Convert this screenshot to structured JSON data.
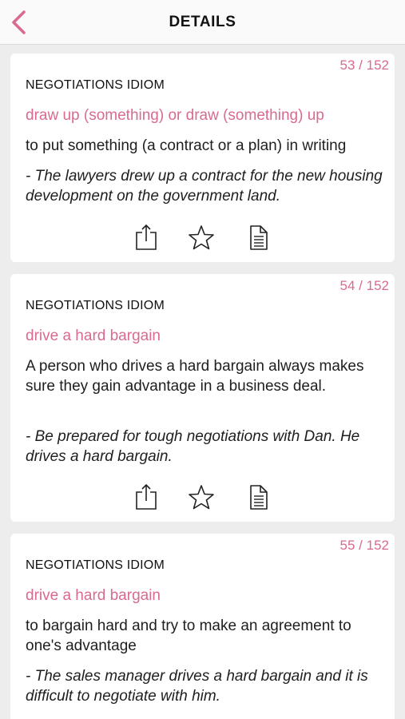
{
  "header": {
    "title": "DETAILS",
    "back_icon": "chevron-left-icon"
  },
  "colors": {
    "accent": "#d96a92",
    "background": "#ededee",
    "card": "#ffffff"
  },
  "cards": [
    {
      "counter": "53 / 152",
      "category": "NEGOTIATIONS IDIOM",
      "idiom": "draw up (something) or draw (something) up",
      "definition": "to put something (a contract or a plan) in writing",
      "example": "- The lawyers drew up a contract for the new housing development on the government land."
    },
    {
      "counter": "54 / 152",
      "category": "NEGOTIATIONS IDIOM",
      "idiom": "drive a hard bargain",
      "definition": "A person who drives a hard bargain always makes sure they gain advantage in a business deal.",
      "example": "- Be prepared for tough negotiations with Dan. He drives a hard  bargain."
    },
    {
      "counter": "55 / 152",
      "category": "NEGOTIATIONS IDIOM",
      "idiom": "drive a hard bargain",
      "definition": "to bargain hard and try to make an agreement to one's advantage",
      "example": "- The sales manager drives a hard bargain and it is difficult to negotiate with him."
    }
  ],
  "action_icons": [
    "share-icon",
    "star-icon",
    "document-icon"
  ]
}
